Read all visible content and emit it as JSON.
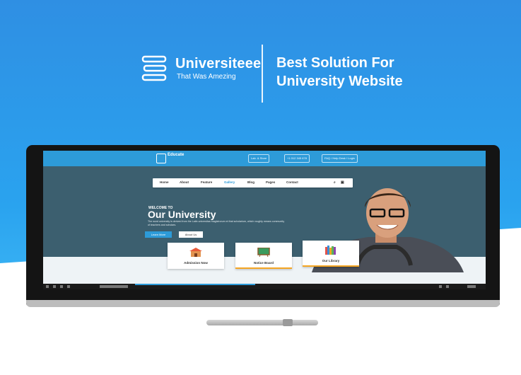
{
  "brand": {
    "name": "Universiteee",
    "tagline": "That Was Amezing"
  },
  "headline": {
    "line1": "Best Solution For",
    "line2": "University Website"
  },
  "screen": {
    "logo_text": "Educate",
    "contact_pills": [
      "Lab. & Store",
      "+1 012 345 678",
      "FAQ / Help Desk / Login"
    ],
    "nav_items": [
      "Home",
      "About",
      "Feature",
      "Gallery",
      "Blog",
      "Pages",
      "Contact"
    ],
    "hero": {
      "welcome": "WELCOME TO",
      "title": "Our University",
      "description": "The word university is derived from the Latin universitas magistrorum et that scholarium, which roughly means community of teachers and scholars.",
      "primary_button": "Learn More",
      "secondary_button": "About Us"
    },
    "cards": [
      {
        "label": "Admission Now"
      },
      {
        "label": "Notice Board"
      },
      {
        "label": "Our Library"
      }
    ]
  },
  "colors": {
    "background_blue": "#2f8fe3",
    "site_accent": "#2d9bd9",
    "hero_dark": "#3c5f6f",
    "card_accent": "#f5a623"
  }
}
